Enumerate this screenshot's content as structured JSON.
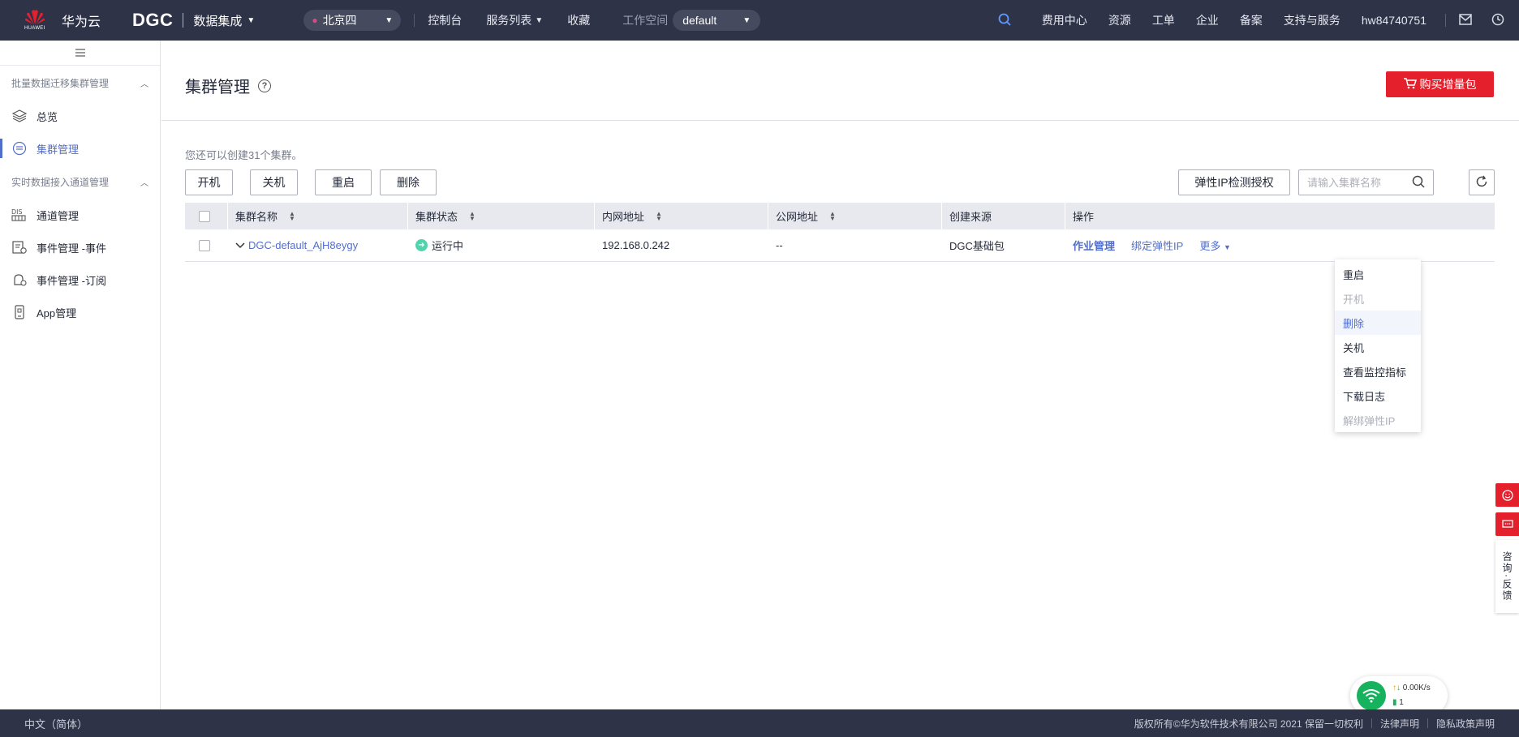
{
  "topbar": {
    "logo_text": "华为云",
    "logo_sub": "HUAWEI",
    "brand": "DGC",
    "product": "数据集成",
    "region": "北京四",
    "nav": [
      "控制台",
      "服务列表",
      "收藏"
    ],
    "workspace_label": "工作空间",
    "workspace_value": "default",
    "right_links": [
      "费用中心",
      "资源",
      "工单",
      "企业",
      "备案",
      "支持与服务"
    ],
    "username": "hw84740751"
  },
  "sidebar": {
    "groups": [
      {
        "title": "批量数据迁移集群管理",
        "items": [
          {
            "label": "总览",
            "icon": "layers-icon"
          },
          {
            "label": "集群管理",
            "icon": "cluster-icon",
            "active": true
          }
        ]
      },
      {
        "title": "实时数据接入通道管理",
        "items": [
          {
            "label": "通道管理",
            "icon": "dis-icon"
          },
          {
            "label": "事件管理 -事件",
            "icon": "event-icon"
          },
          {
            "label": "事件管理 -订阅",
            "icon": "subscription-icon"
          },
          {
            "label": "App管理",
            "icon": "app-icon"
          }
        ]
      }
    ]
  },
  "page": {
    "title": "集群管理",
    "buy_button": "购买增量包",
    "tip": "您还可以创建31个集群。",
    "actions": [
      "开机",
      "关机",
      "重启",
      "删除"
    ],
    "eip_button": "弹性IP检测授权",
    "search_placeholder": "请输入集群名称"
  },
  "table": {
    "headers": [
      "集群名称",
      "集群状态",
      "内网地址",
      "公网地址",
      "创建来源",
      "操作"
    ],
    "rows": [
      {
        "name": "DGC-default_AjH8eygy",
        "status": "运行中",
        "private_ip": "192.168.0.242",
        "public_ip": "--",
        "source": "DGC基础包",
        "ops": [
          "作业管理",
          "绑定弹性IP",
          "更多"
        ]
      }
    ]
  },
  "more_menu": {
    "items": [
      {
        "label": "重启",
        "state": "normal"
      },
      {
        "label": "开机",
        "state": "disabled"
      },
      {
        "label": "删除",
        "state": "hover"
      },
      {
        "label": "关机",
        "state": "normal"
      },
      {
        "label": "查看监控指标",
        "state": "normal"
      },
      {
        "label": "下载日志",
        "state": "normal"
      },
      {
        "label": "解绑弹性IP",
        "state": "disabled"
      }
    ]
  },
  "floating": {
    "feedback": "咨询·反馈"
  },
  "net_widget": {
    "speed": "0.00K/s",
    "count": "1"
  },
  "footer": {
    "language": "中文（简体）",
    "copyright": "版权所有©华为软件技术有限公司 2021 保留一切权利",
    "legal": "法律声明",
    "privacy": "隐私政策声明"
  },
  "colors": {
    "topbar_bg": "#2e3348",
    "accent": "#526ecc",
    "buy_red": "#e4202d",
    "status_green": "#50d4ab"
  }
}
